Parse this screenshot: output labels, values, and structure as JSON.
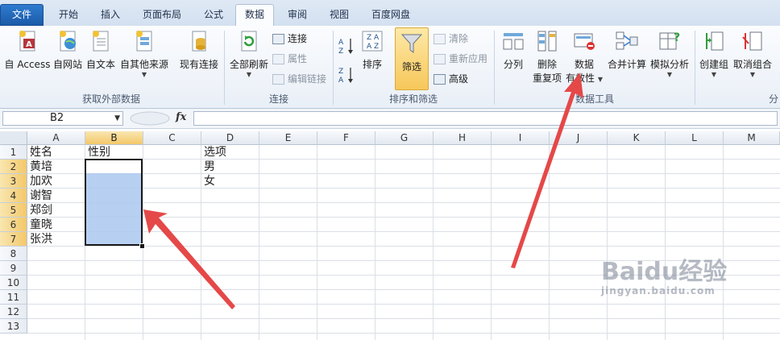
{
  "tabs": [
    "文件",
    "开始",
    "插入",
    "页面布局",
    "公式",
    "数据",
    "审阅",
    "视图",
    "百度网盘"
  ],
  "ribbon": {
    "get_external": {
      "access": "自 Access",
      "web": "自网站",
      "text": "自文本",
      "other": "自其他来源",
      "existing": "现有连接",
      "label": "获取外部数据"
    },
    "connections": {
      "refresh": "全部刷新",
      "connect": "连接",
      "properties": "属性",
      "edit_links": "编辑链接",
      "label": "连接"
    },
    "sort_filter": {
      "sort": "排序",
      "filter": "筛选",
      "clear": "清除",
      "reapply": "重新应用",
      "advanced": "高级",
      "label": "排序和筛选"
    },
    "data_tools": {
      "text_to_columns": "分列",
      "remove_dup_1": "删除",
      "remove_dup_2": "重复项",
      "validation_1": "数据",
      "validation_2": "有效性",
      "consolidate": "合并计算",
      "whatif": "模拟分析",
      "label": "数据工具"
    },
    "outline": {
      "group": "创建组",
      "ungroup": "取消组合",
      "label": "分"
    }
  },
  "formula_bar": {
    "name_box": "B2",
    "fx": "fx",
    "value": ""
  },
  "columns": [
    "A",
    "B",
    "C",
    "D",
    "E",
    "F",
    "G",
    "H",
    "I",
    "J",
    "K",
    "L",
    "M"
  ],
  "rows": [
    "1",
    "2",
    "3",
    "4",
    "5",
    "6",
    "7",
    "8",
    "9",
    "10",
    "11",
    "12",
    "13"
  ],
  "cells": {
    "A1": "姓名",
    "A2": "黄培",
    "A3": "加欢",
    "A4": "谢智",
    "A5": "郑剑",
    "A6": "童晓",
    "A7": "张洪",
    "B1": "性别",
    "D1": "选项",
    "D2": "男",
    "D3": "女"
  },
  "colors": {
    "selection_fill": "#aac8ee",
    "arrow": "#e54848",
    "file_tab": "#2066b8"
  },
  "watermark": {
    "line1": "Baidu经验",
    "line2": "jingyan.baidu.com"
  }
}
